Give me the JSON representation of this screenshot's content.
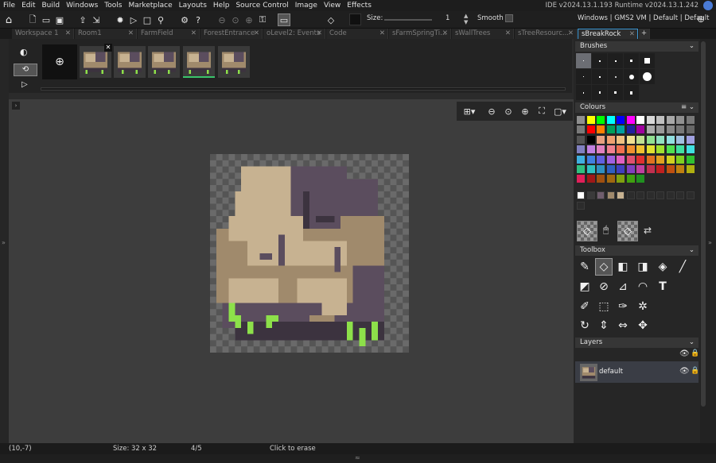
{
  "menu": {
    "items": [
      "File",
      "Edit",
      "Build",
      "Windows",
      "Tools",
      "Marketplace",
      "Layouts",
      "Help",
      "Source Control",
      "Image",
      "View",
      "Effects"
    ],
    "version_text": "IDE v2024.13.1.193  Runtime v2024.13.1.242"
  },
  "toolbar": {
    "size_label": "Size:",
    "size_value": "1",
    "smooth_label": "Smooth",
    "target_text": "Windows | GMS2 VM | Default | Default"
  },
  "tabs": [
    {
      "label": "Workspace 1",
      "active": false
    },
    {
      "label": "Room1",
      "active": false
    },
    {
      "label": "FarmField",
      "active": false
    },
    {
      "label": "ForestEntrance",
      "active": false
    },
    {
      "label": "oLevel2: Events",
      "active": false
    },
    {
      "label": "Code",
      "active": false
    },
    {
      "label": "sFarmSpringTi...",
      "active": false
    },
    {
      "label": "sWallTrees",
      "active": false
    },
    {
      "label": "sTreeResourc...",
      "active": false
    },
    {
      "label": "sBreakRock",
      "active": true
    }
  ],
  "frames": {
    "count": 5,
    "selected_index": 3
  },
  "panels": {
    "brushes": "Brushes",
    "colours": "Colours",
    "toolbox": "Toolbox",
    "layers": "Layers"
  },
  "layers": [
    {
      "name": "default"
    }
  ],
  "status": {
    "coords": "(10,-7)",
    "size": "Size: 32 x 32",
    "frame": "4/5",
    "hint": "Click to erase"
  },
  "colors": {
    "accent": "#3f9ad6",
    "selected_frame": "#39c46b",
    "rock_light": "#c7b291",
    "rock_mid": "#a08a6c",
    "rock_dark": "#5b4d5e",
    "rock_shadow": "#3c333f",
    "grass": "#8de04a"
  },
  "palette_row1": [
    "#8f8f8f",
    "#ffff00",
    "#00ff00",
    "#00ffff",
    "#0000ff",
    "#ff00ff",
    "#ffffff",
    "#d8d8d8",
    "#c0c0c0",
    "#a8a8a8",
    "#909090",
    "#787878"
  ],
  "palette_row2": [
    "#7a7a7a",
    "#ff0000",
    "#ff8000",
    "#009f5a",
    "#00a0a0",
    "#2020a0",
    "#a000a0",
    "#aaaaaa",
    "#999999",
    "#888888",
    "#777777",
    "#666666"
  ],
  "palette_row3": [
    "#555555",
    "#000000",
    "#e8a080",
    "#f0a070",
    "#f0c080",
    "#f0e090",
    "#c0e090",
    "#90e090",
    "#90e0c0",
    "#90e0e0",
    "#a0c0e0",
    "#a0a0e0"
  ],
  "palette_row4": [
    "#8080c0",
    "#c080e0",
    "#e080c0",
    "#f08090",
    "#f07050",
    "#f09030",
    "#f0c030",
    "#e0e030",
    "#a0e030",
    "#50e050",
    "#40e0a0",
    "#40e0e0"
  ],
  "palette_row5": [
    "#40b0e0",
    "#4080e0",
    "#6060e0",
    "#a060e0",
    "#e060c0",
    "#e05070",
    "#e03030",
    "#e07020",
    "#e0a020",
    "#d0d020",
    "#80d020",
    "#30c030"
  ],
  "palette_row6": [
    "#30c080",
    "#30c0c0",
    "#3090c0",
    "#3060c0",
    "#4040c0",
    "#8040c0",
    "#c040a0",
    "#c03050",
    "#c02020",
    "#c05010",
    "#c08010",
    "#b0b010"
  ],
  "palette_row7": [
    "#e0205a",
    "#a01818",
    "#a05010",
    "#a06810",
    "#80a010",
    "#40a010",
    "#209020"
  ],
  "palette_row8": [
    "#ffffff",
    "#3a3a3a",
    "#6f5d6d",
    "#a08a6c",
    "#c7b291",
    "#2c2c2c",
    "#2c2c2c",
    "#2c2c2c",
    "#2c2c2c",
    "#2c2c2c",
    "#2c2c2c",
    "#2c2c2c"
  ],
  "icons": {
    "home": "home-icon",
    "user": "user-icon",
    "target": "crosshair-icon"
  }
}
